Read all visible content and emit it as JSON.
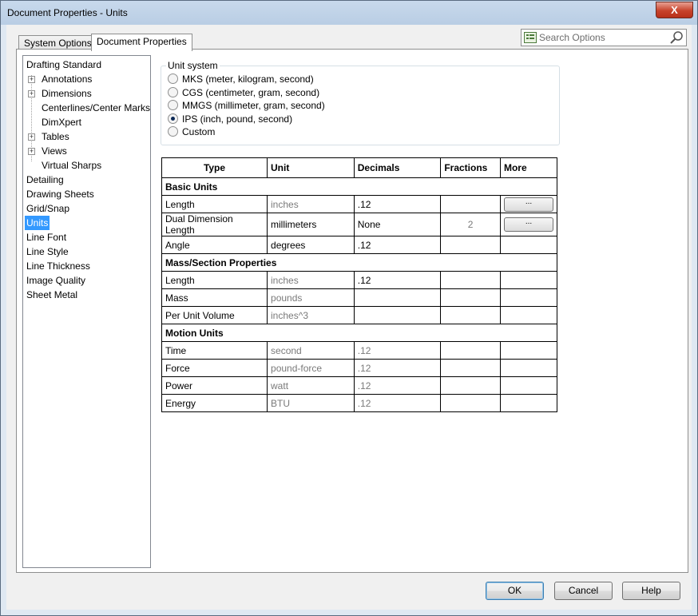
{
  "window": {
    "title": "Document Properties - Units",
    "close_label": "X"
  },
  "tabs": [
    {
      "label": "System Options",
      "active": false
    },
    {
      "label": "Document Properties",
      "active": true
    }
  ],
  "search": {
    "placeholder": "Search Options",
    "icon": "search-icon"
  },
  "tree": {
    "items": [
      {
        "label": "Drafting Standard",
        "selected": false
      },
      {
        "label": "Annotations",
        "expandable": true
      },
      {
        "label": "Dimensions",
        "expandable": true
      },
      {
        "label": "Centerlines/Center Marks"
      },
      {
        "label": "DimXpert"
      },
      {
        "label": "Tables",
        "expandable": true
      },
      {
        "label": "Views",
        "expandable": true
      },
      {
        "label": "Virtual Sharps"
      },
      {
        "label": "Detailing"
      },
      {
        "label": "Drawing Sheets"
      },
      {
        "label": "Grid/Snap"
      },
      {
        "label": "Units",
        "selected": true
      },
      {
        "label": "Line Font"
      },
      {
        "label": "Line Style"
      },
      {
        "label": "Line Thickness"
      },
      {
        "label": "Image Quality"
      },
      {
        "label": "Sheet Metal"
      }
    ]
  },
  "unit_system": {
    "label": "Unit system",
    "options": [
      {
        "label": "MKS  (meter, kilogram, second)",
        "checked": false
      },
      {
        "label": "CGS  (centimeter, gram, second)",
        "checked": false
      },
      {
        "label": "MMGS  (millimeter, gram, second)",
        "checked": false
      },
      {
        "label": "IPS  (inch, pound, second)",
        "checked": true
      },
      {
        "label": "Custom",
        "checked": false
      }
    ]
  },
  "table": {
    "headers": {
      "type": "Type",
      "unit": "Unit",
      "decimals": "Decimals",
      "fractions": "Fractions",
      "more": "More"
    },
    "sections": {
      "basic": "Basic Units",
      "mass": "Mass/Section Properties",
      "motion": "Motion Units"
    },
    "rows": {
      "length": {
        "type": "Length",
        "unit": "inches",
        "decimals": ".12",
        "more": "..."
      },
      "dual": {
        "type": "Dual Dimension Length",
        "unit": "millimeters",
        "decimals": "None",
        "fractions": "2",
        "more": "..."
      },
      "angle": {
        "type": "Angle",
        "unit": "degrees",
        "decimals": ".12"
      },
      "mlength": {
        "type": "Length",
        "unit": "inches",
        "decimals": ".12"
      },
      "mass": {
        "type": "Mass",
        "unit": "pounds"
      },
      "volume": {
        "type": "Per Unit Volume",
        "unit": "inches^3"
      },
      "time": {
        "type": "Time",
        "unit": "second",
        "decimals": ".12"
      },
      "force": {
        "type": "Force",
        "unit": "pound-force",
        "decimals": ".12"
      },
      "power": {
        "type": "Power",
        "unit": "watt",
        "decimals": ".12"
      },
      "energy": {
        "type": "Energy",
        "unit": "BTU",
        "decimals": ".12"
      }
    }
  },
  "buttons": {
    "ok": "OK",
    "cancel": "Cancel",
    "help": "Help"
  }
}
